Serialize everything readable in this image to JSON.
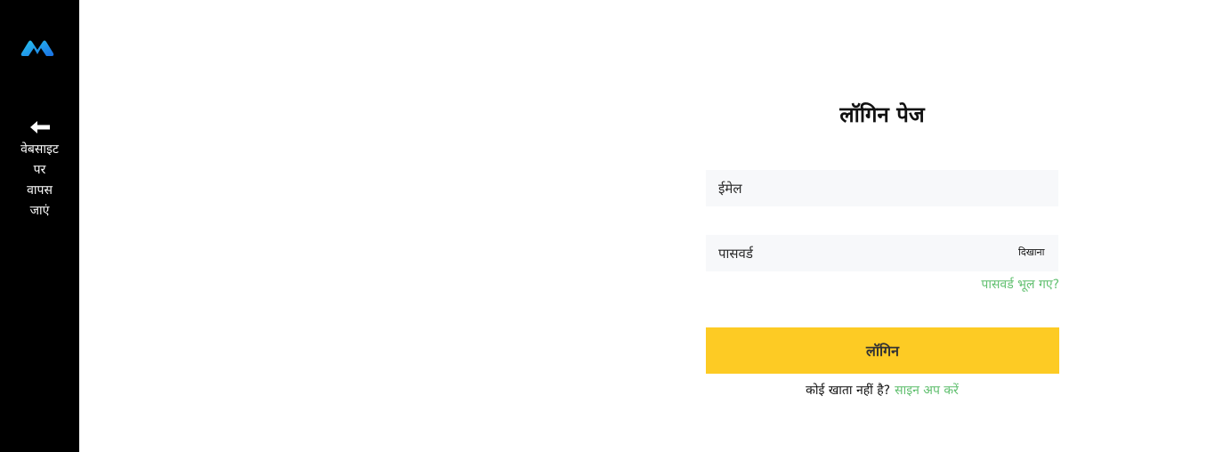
{
  "sidebar": {
    "logo_icon": "brand-logo-icon",
    "logo_colors": [
      "#1a8fe3",
      "#29c7f0"
    ],
    "back_icon": "arrow-left-icon",
    "back_lines": [
      "वेबसाइट",
      "पर",
      "वापस",
      "जाएं"
    ]
  },
  "login": {
    "title": "लॉगिन पेज",
    "email_placeholder": "ईमेल",
    "password_placeholder": "पासवर्ड",
    "show_password_label": "दिखाना",
    "forgot_password_label": "पासवर्ड भूल गए?",
    "login_button_label": "लॉगिन",
    "no_account_text": "कोई खाता नहीं है?",
    "signup_label": "साइन अप करें"
  },
  "colors": {
    "sidebar_bg": "#000000",
    "accent_button": "#fdcb24",
    "link_green": "#5fbf6e",
    "field_bg": "#f7f8fa"
  }
}
